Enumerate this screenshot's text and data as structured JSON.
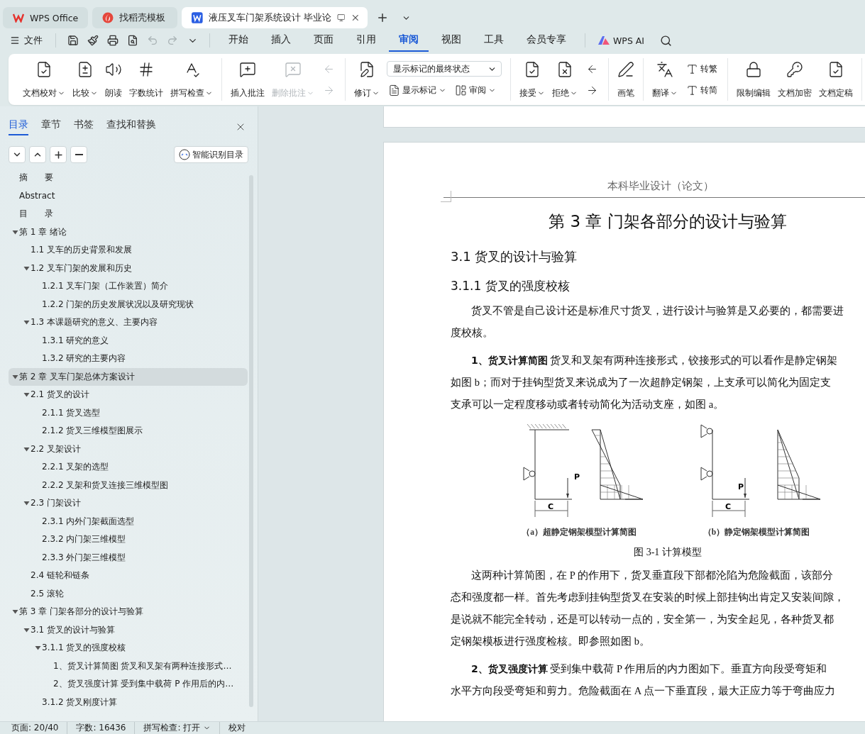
{
  "app_tabs": [
    {
      "kind": "home",
      "label": "WPS Office",
      "selected": false
    },
    {
      "kind": "template",
      "label": "找稻壳模板",
      "selected": false
    },
    {
      "kind": "document",
      "label": "液压叉车门架系统设计 毕业论",
      "selected": true
    }
  ],
  "menu": {
    "file": "文件",
    "undo": {
      "disabled": true
    },
    "redo": {
      "disabled": true
    },
    "tabs": [
      {
        "label": "开始",
        "selected": false
      },
      {
        "label": "插入",
        "selected": false
      },
      {
        "label": "页面",
        "selected": false
      },
      {
        "label": "引用",
        "selected": false
      },
      {
        "label": "审阅",
        "selected": true
      },
      {
        "label": "视图",
        "selected": false
      },
      {
        "label": "工具",
        "selected": false
      },
      {
        "label": "会员专享",
        "selected": false
      }
    ],
    "ai": "WPS AI"
  },
  "ribbon": [
    {
      "items": [
        {
          "kind": "large",
          "label": "文档校对",
          "dropdown": true
        },
        {
          "kind": "large",
          "label": "比较",
          "dropdown": true
        },
        {
          "kind": "large",
          "label": "朗读",
          "dropdown": false
        },
        {
          "kind": "large",
          "label": "字数统计",
          "dropdown": false
        },
        {
          "kind": "large",
          "label": "拼写检查",
          "dropdown": true
        }
      ]
    },
    {
      "items": [
        {
          "kind": "large",
          "label": "插入批注",
          "dropdown": false,
          "disabled": false
        },
        {
          "kind": "large",
          "label": "删除批注",
          "dropdown": true,
          "disabled": true
        },
        {
          "kind": "column",
          "rows": [
            [
              {
                "kind": "small",
                "disabled": true
              }
            ],
            [
              {
                "kind": "small",
                "disabled": true
              }
            ]
          ]
        }
      ]
    },
    {
      "items": [
        {
          "kind": "large",
          "label": "修订",
          "dropdown": true
        },
        {
          "kind": "column",
          "rows": [
            [
              {
                "kind": "select",
                "value": "显示标记的最终状态"
              }
            ],
            [
              {
                "kind": "small",
                "label": "显示标记",
                "dropdown": true
              },
              {
                "kind": "small",
                "label": "审阅",
                "dropdown": true
              }
            ]
          ]
        }
      ]
    },
    {
      "items": [
        {
          "kind": "large",
          "label": "接受",
          "dropdown": true
        },
        {
          "kind": "large",
          "label": "拒绝",
          "dropdown": true
        },
        {
          "kind": "column",
          "rows": [
            [
              {
                "kind": "small",
                "disabled": false
              }
            ],
            [
              {
                "kind": "small",
                "disabled": false
              }
            ]
          ]
        }
      ]
    },
    {
      "items": [
        {
          "kind": "large",
          "label": "画笔",
          "dropdown": false
        }
      ]
    },
    {
      "items": [
        {
          "kind": "large",
          "label": "翻译",
          "dropdown": true
        },
        {
          "kind": "column",
          "rows": [
            [
              {
                "kind": "small",
                "label": "转繁"
              }
            ],
            [
              {
                "kind": "small",
                "label": "转简"
              }
            ]
          ]
        }
      ]
    },
    {
      "items": [
        {
          "kind": "large",
          "label": "限制编辑",
          "dropdown": false
        },
        {
          "kind": "large",
          "label": "文档加密",
          "dropdown": false
        },
        {
          "kind": "large",
          "label": "文档定稿",
          "dropdown": false
        }
      ]
    }
  ],
  "sidebar": {
    "tabs": [
      {
        "label": "目录",
        "selected": true
      },
      {
        "label": "章节",
        "selected": false
      },
      {
        "label": "书签",
        "selected": false
      },
      {
        "label": "查找和替换",
        "selected": false
      }
    ],
    "smart_toc_button": "智能识别目录",
    "toc": [
      {
        "label": "摘　　要",
        "selected": false
      },
      {
        "label": "Abstract",
        "selected": false
      },
      {
        "label": "目　　录",
        "selected": false
      },
      {
        "label": "第 1 章  绪论",
        "selected": false,
        "expanded": true,
        "children": [
          {
            "label": "1.1  叉车的历史背景和发展",
            "selected": false
          },
          {
            "label": "1.2  叉车门架的发展和历史",
            "selected": false,
            "expanded": true,
            "children": [
              {
                "label": "1.2.1  叉车门架（工作装置）简介",
                "selected": false
              },
              {
                "label": "1.2.2  门架的历史发展状况以及研究现状",
                "selected": false
              }
            ]
          },
          {
            "label": "1.3  本课题研究的意义、主要内容",
            "selected": false,
            "expanded": true,
            "children": [
              {
                "label": "1.3.1  研究的意义",
                "selected": false
              },
              {
                "label": "1.3.2  研究的主要内容",
                "selected": false
              }
            ]
          }
        ]
      },
      {
        "label": "第 2 章  叉车门架总体方案设计",
        "selected": true,
        "expanded": true,
        "children": [
          {
            "label": "2.1  货叉的设计",
            "selected": false,
            "expanded": true,
            "children": [
              {
                "label": "2.1.1  货叉选型",
                "selected": false
              },
              {
                "label": "2.1.2  货叉三维模型图展示",
                "selected": false
              }
            ]
          },
          {
            "label": "2.2  叉架设计",
            "selected": false,
            "expanded": true,
            "children": [
              {
                "label": "2.2.1  叉架的选型",
                "selected": false
              },
              {
                "label": "2.2.2  叉架和货叉连接三维模型图",
                "selected": false
              }
            ]
          },
          {
            "label": "2.3  门架设计",
            "selected": false,
            "expanded": true,
            "children": [
              {
                "label": "2.3.1  内外门架截面选型",
                "selected": false
              },
              {
                "label": "2.3.2  内门架三维模型",
                "selected": false
              },
              {
                "label": "2.3.3  外门架三维模型",
                "selected": false
              }
            ]
          },
          {
            "label": "2.4  链轮和链条",
            "selected": false
          },
          {
            "label": "2.5  滚轮",
            "selected": false
          }
        ]
      },
      {
        "label": "第 3 章  门架各部分的设计与验算",
        "selected": false,
        "expanded": true,
        "children": [
          {
            "label": "3.1  货叉的设计与验算",
            "selected": false,
            "expanded": true,
            "children": [
              {
                "label": "3.1.1  货叉的强度校核",
                "selected": false,
                "expanded": true,
                "children": [
                  {
                    "label": "1、货叉计算简图  货叉和叉架有两种连接形式…",
                    "selected": false
                  },
                  {
                    "label": "2、货叉强度计算  受到集中载荷 P 作用后的内…",
                    "selected": false
                  }
                ]
              },
              {
                "label": "3.1.2  货叉刚度计算",
                "selected": false
              }
            ]
          }
        ]
      }
    ]
  },
  "document": {
    "header": "本科毕业设计（论文）",
    "blocks": [
      {
        "kind": "chapter",
        "text": "第 3 章  门架各部分的设计与验算"
      },
      {
        "kind": "section",
        "text": "3.1  货叉的设计与验算"
      },
      {
        "kind": "subsection",
        "text": "3.1.1  货叉的强度校核"
      },
      {
        "kind": "paragraph",
        "lines": [
          "货叉不管是自己设计还是标准尺寸货叉，进行设计与验算是又必要的，都需要进",
          "度校核。"
        ]
      },
      {
        "kind": "paragraph",
        "lines": [
          "**1、货叉计算简图** 货叉和叉架有两种连接形式，铰接形式的可以看作是静定钢架",
          "如图 b；而对于挂钩型货叉来说成为了一次超静定钢架，上支承可以简化为固定支",
          "支承可以一定程度移动或者转动简化为活动支座，如图 a。"
        ]
      },
      {
        "kind": "figure",
        "panels": [
          {
            "kind": "fixed",
            "caption": "（a）超静定钢架模型计算简图",
            "load_label": "P",
            "dimension_label": "C"
          },
          {
            "kind": "pinned",
            "caption": "（b）静定钢架模型计算简图",
            "load_label": "P",
            "dimension_label": "C"
          }
        ],
        "caption": "图 3-1  计算模型"
      },
      {
        "kind": "paragraph",
        "lines": [
          "这两种计算简图，在 P 的作用下，货叉垂直段下部都沦陷为危险截面，该部分",
          "态和强度都一样。首先考虑到挂钩型货叉在安装的时候上部挂钩出肯定又安装间隙，",
          "是说就不能完全转动，还是可以转动一点的，安全第一，为安全起见，各种货叉都",
          "定钢架模板进行强度检核。即参照如图 b。"
        ]
      },
      {
        "kind": "paragraph",
        "lines": [
          "**2、货叉强度计算** 受到集中载荷 P 作用后的内力图如下。垂直方向段受弯矩和",
          "水平方向段受弯矩和剪力。危险截面在 A 点一下垂直段，最大正应力等于弯曲应力"
        ]
      }
    ]
  },
  "status_bar": [
    {
      "label": "页面: 20/40",
      "dropdown": false
    },
    {
      "label": "字数: 16436",
      "dropdown": false
    },
    {
      "label": "拼写检查: 打开",
      "dropdown": true
    },
    {
      "label": "校对",
      "dropdown": false
    }
  ]
}
